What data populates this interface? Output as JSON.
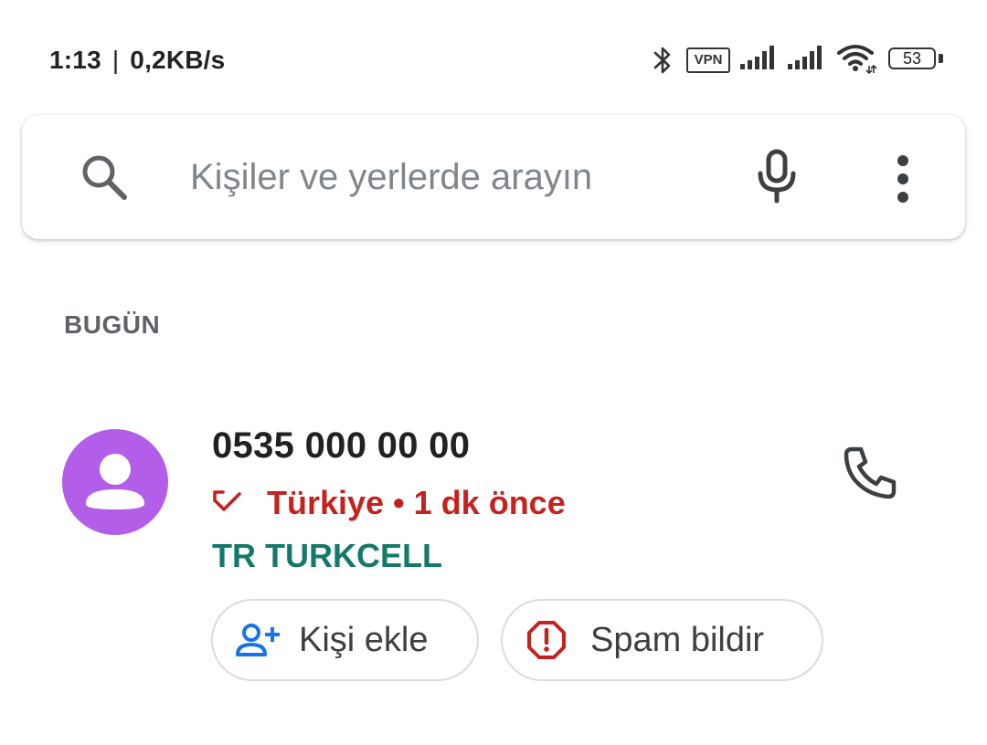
{
  "status_bar": {
    "time": "1:13",
    "separator": "|",
    "network_speed": "0,2KB/s",
    "vpn_label": "VPN",
    "battery_level": "53",
    "icons": [
      "bluetooth-icon",
      "vpn-icon",
      "signal-icon",
      "signal-icon",
      "wifi-icon",
      "battery-icon"
    ]
  },
  "search": {
    "placeholder": "Kişiler ve yerlerde arayın",
    "value": "",
    "icons": [
      "search-icon",
      "microphone-icon",
      "more-vert-icon"
    ]
  },
  "section": {
    "header": "BUGÜN"
  },
  "calls": [
    {
      "number": "0535 000 00 00",
      "meta": "Türkiye • 1 dk önce",
      "carrier": "TR TURKCELL",
      "call_type_icon": "missed-call-icon",
      "avatar_icon": "person-icon",
      "action_icon": "phone-icon",
      "actions": {
        "add_contact": "Kişi ekle",
        "report_spam": "Spam bildir"
      }
    }
  ],
  "colors": {
    "avatar": "#b25ee8",
    "missed": "#c5221f",
    "carrier": "#137a6a",
    "accent_blue": "#1a73e8"
  }
}
